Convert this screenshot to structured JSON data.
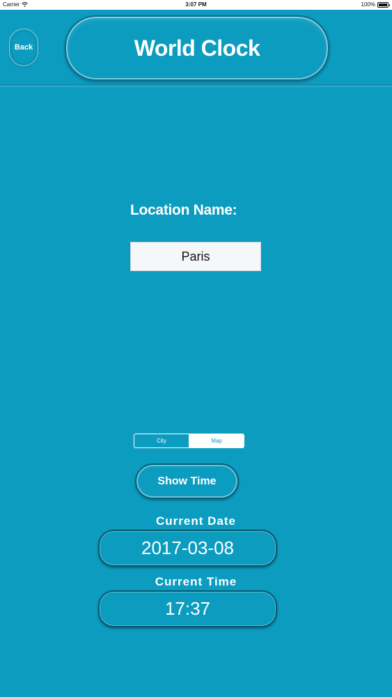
{
  "status_bar": {
    "carrier": "Carrier",
    "time": "3:07 PM",
    "battery": "100%",
    "wifi_icon": "wifi-icon",
    "battery_icon": "battery-icon"
  },
  "header": {
    "back_label": "Back",
    "title": "World Clock"
  },
  "location": {
    "label": "Location Name:",
    "value": "Paris",
    "placeholder": ""
  },
  "segmented": {
    "options": [
      "City",
      "Map"
    ],
    "selected": "Map"
  },
  "actions": {
    "show_time_label": "Show Time"
  },
  "results": {
    "date_label": "Current Date",
    "date_value": "2017-03-08",
    "time_label": "Current Time",
    "time_value": "17:37"
  },
  "colors": {
    "background": "#0c9cc0",
    "text": "#ffffff",
    "border": "#06566c"
  }
}
